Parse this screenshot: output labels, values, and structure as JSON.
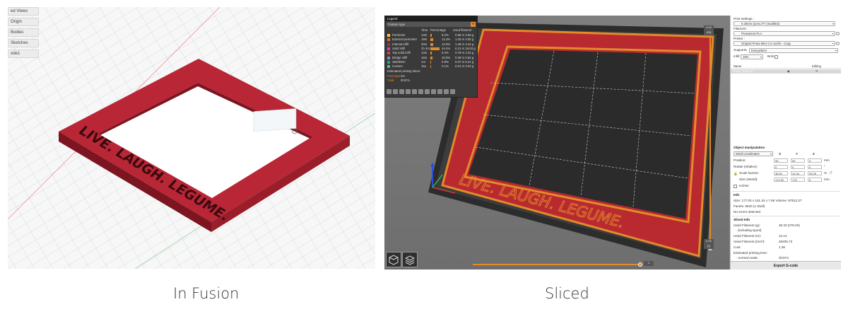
{
  "captions": {
    "left": "In Fusion",
    "right": "Sliced"
  },
  "fusion": {
    "browser_items": [
      "ed Views",
      "Origin",
      "Bodies",
      "Sketches",
      "ode1"
    ],
    "frame_text": "LIVE. LAUGH. LEGUME.",
    "colors": {
      "frame": "#b92635",
      "frame_dark": "#7d1520",
      "background": "#f7f7f7"
    }
  },
  "slicer": {
    "legend": {
      "title": "Legend",
      "view_type": "Feature type",
      "headers": [
        "",
        "Time",
        "Percentage",
        "Used filament"
      ],
      "rows": [
        {
          "name": "Perimeter",
          "time": "13m",
          "pct": "8.2%",
          "used": "0.86 m  2.58 g",
          "color": "#f7c94b",
          "pct_value": 8.2
        },
        {
          "name": "External perimeter",
          "time": "19m",
          "pct": "12.3%",
          "used": "1.00 m  3.00 g",
          "color": "#e06d3a",
          "pct_value": 12.3
        },
        {
          "name": "Internal infill",
          "time": "20m",
          "pct": "12.8%",
          "used": "1.48 m  4.44 g",
          "color": "#a9304c",
          "pct_value": 12.8
        },
        {
          "name": "Solid infill",
          "time": "1h 4m",
          "pct": "44.4%",
          "used": "6.21 m  18.63 g",
          "color": "#c44bbf",
          "pct_value": 44.4
        },
        {
          "name": "Top solid infill",
          "time": "13m",
          "pct": "8.3%",
          "used": "0.78 m  2.34 g",
          "color": "#f03b3b",
          "pct_value": 8.3
        },
        {
          "name": "Bridge infill",
          "time": "16m",
          "pct": "10.0%",
          "used": "0.28 m  0.84 g",
          "color": "#7a8fc9",
          "pct_value": 10.0
        },
        {
          "name": "Skirt/Brim",
          "time": "1m",
          "pct": "0.9%",
          "used": "0.07 m  0.21 g",
          "color": "#2c9c8c",
          "pct_value": 0.9
        },
        {
          "name": "Custom",
          "time": "15s",
          "pct": "0.1%",
          "used": "0.01 m  0.03 g",
          "color": "#43c6a2",
          "pct_value": 0.1
        }
      ],
      "estimated_label": "Estimated printing times:",
      "first_layer_label": "First layer:",
      "first_layer_value": "2m",
      "total_label": "Total:",
      "total_value": "2h37m"
    },
    "slider": {
      "top_value": "5.00",
      "top_layer": "(25)",
      "bottom_value": "0.20",
      "bottom_layer": "(1)",
      "h_value": "1"
    },
    "plate_text": "LIVE. LAUGH. LEGUME.",
    "colors": {
      "print": "#b82a30",
      "outline": "#e28b2a",
      "bed": "#3a3a3a"
    },
    "sidebar": {
      "print_settings_label": "Print settings :",
      "print_settings_value": "0.20mm QUALITY (modified)",
      "filament_label": "Filament :",
      "filament_value": "Prusament PLA",
      "printer_label": "Printer :",
      "printer_value": "Original Prusa MK4 0.4 nozzle - Copy",
      "supports_label": "Supports:",
      "supports_value": "Everywhere",
      "infill_label": "Infill:",
      "infill_value": "15%",
      "brim_label": "Brim:",
      "list_headers": {
        "name": "Name",
        "editing": "Editing"
      },
      "object_name": "frame_body.stl",
      "object_manipulation": "Object manipulation",
      "coords": "World coordinates",
      "axes": [
        "X",
        "Y",
        "Z"
      ],
      "position_label": "Position:",
      "position": [
        "90",
        "90",
        "3"
      ],
      "position_unit": "mm",
      "rotate_label": "Rotate (relative):",
      "rotate": [
        "0",
        "0",
        "0"
      ],
      "rotate_unit": "°",
      "scale_label": "Scale factors:",
      "scale": [
        "46.51",
        "41.04",
        "26.29"
      ],
      "scale_unit": "%",
      "size_label": "Size (World):",
      "size": [
        "174.92",
        "175",
        "6"
      ],
      "size_unit": "mm",
      "inches_label": "Inches",
      "info_title": "Info",
      "size_info": "Size:   177.00 x 161.34 x 7.66    Volume:   87812.37",
      "facets_info": "Facets:   9620 (1 shell)",
      "errors_info": "No errors detected",
      "sliced_title": "Sliced Info",
      "used_g_label": "Used Filament (g):",
      "used_g": "36.33 (375.03)",
      "spool_label": "(including spool)",
      "used_m_label": "Used Filament (m):",
      "used_m": "12.14",
      "used_mm3_label": "Used Filament (mm³):",
      "used_mm3": "29205.73",
      "cost_label": "Cost:",
      "cost": "1.36",
      "est_time_label": "Estimated printing time:",
      "normal_mode_label": "- normal mode:",
      "normal_mode": "2h37m",
      "export_label": "Export G-code"
    }
  }
}
